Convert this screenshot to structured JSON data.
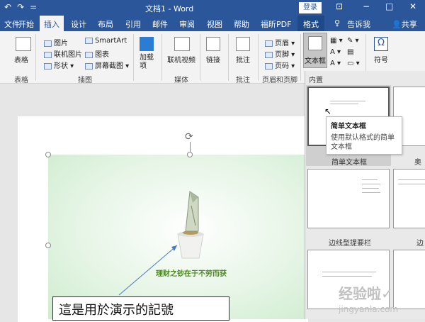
{
  "titlebar": {
    "undo_icon": "undo-icon",
    "redo_icon": "redo-icon",
    "qat_more": "=",
    "title": "文档1 - Word",
    "login": "登录",
    "minimize": "−",
    "maximize": "□",
    "close": "✕"
  },
  "tabs": {
    "file": "文件",
    "home": "开始",
    "insert": "插入",
    "design": "设计",
    "layout": "布局",
    "references": "引用",
    "mailings": "邮件",
    "review": "审阅",
    "view": "视图",
    "help": "帮助",
    "foxit": "福昕PDF",
    "format": "格式",
    "tellme": "告诉我",
    "share": "共享"
  },
  "ribbon": {
    "table": "表格",
    "table_group": "表格",
    "picture": "图片",
    "online_picture": "联机图片",
    "shapes": "形状",
    "smartart": "SmartArt",
    "chart": "图表",
    "screenshot": "屏幕截图",
    "illustrations_group": "插图",
    "addins": "加载\n项",
    "online_video": "联机视频",
    "media_group": "媒体",
    "links": "链接",
    "comment": "批注",
    "comments_group": "批注",
    "header": "页眉",
    "footer": "页脚",
    "page_number": "页码",
    "header_footer_group": "页眉和页脚",
    "textbox": "文本框",
    "symbol": "符号"
  },
  "document": {
    "slogan": "理财之钞在于不劳而获",
    "callout_text": "這是用於演示的記號"
  },
  "gallery": {
    "section_header": "内置",
    "items": [
      {
        "label": "简单文本框"
      },
      {
        "label": "奥斯"
      },
      {
        "label": "边线型提要栏"
      },
      {
        "label": "边线"
      }
    ]
  },
  "tooltip": {
    "title": "简单文本框",
    "description": "使用默认格式的简单文本框"
  },
  "watermark": {
    "line1": "经验啦✓",
    "line2": "jingyanla.com"
  },
  "colors": {
    "brand": "#2b579a",
    "ribbon_bg": "#f3f3f3",
    "slogan_green": "#4a8a1e"
  }
}
